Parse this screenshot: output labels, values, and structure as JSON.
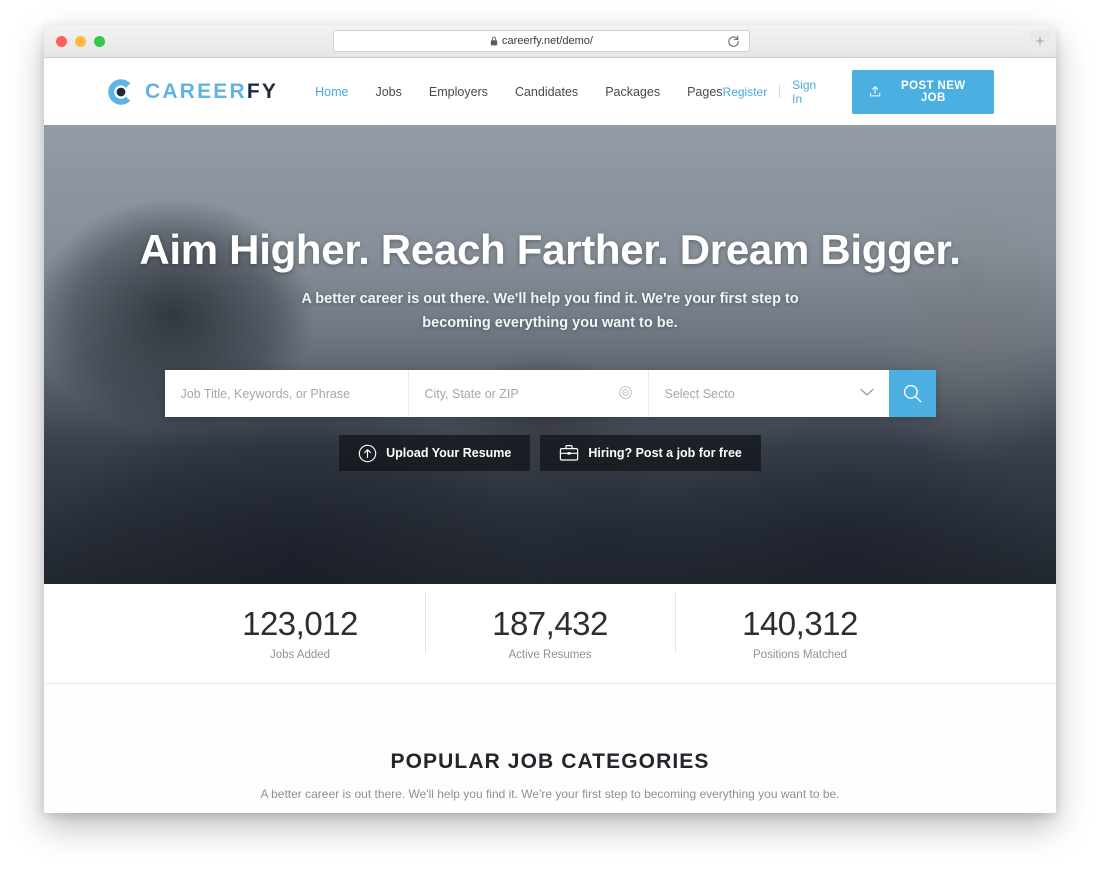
{
  "browser": {
    "url": "careerfy.net/demo/",
    "lock_icon": "lock-icon",
    "reload_icon": "reload-icon",
    "new_tab_label": "+"
  },
  "header": {
    "logo": {
      "icon": "careerfy-c-logo-icon",
      "text_primary": "CAREER",
      "text_secondary": "FY",
      "primary_color": "#5fb4e5",
      "secondary_color": "#1f2b3d"
    },
    "nav": [
      {
        "label": "Home",
        "active": true
      },
      {
        "label": "Jobs",
        "active": false
      },
      {
        "label": "Employers",
        "active": false
      },
      {
        "label": "Candidates",
        "active": false
      },
      {
        "label": "Packages",
        "active": false
      },
      {
        "label": "Pages",
        "active": false
      }
    ],
    "register_label": "Register",
    "signin_label": "Sign In",
    "post_job": {
      "label": "POST NEW JOB",
      "icon": "upload-icon",
      "color": "#4bafe2"
    }
  },
  "hero": {
    "title": "Aim Higher. Reach Farther. Dream Bigger.",
    "subtitle": "A better career is out there. We'll help you find it. We're your first step to becoming everything you want to be.",
    "search": {
      "keywords_placeholder": "Job Title, Keywords, or Phrase",
      "keywords_value": "",
      "location_placeholder": "City, State or ZIP",
      "location_value": "",
      "location_icon": "geolocation-target-icon",
      "sector_value": "Select Secto",
      "sector_icon": "chevron-down-icon",
      "submit_icon": "search-icon",
      "submit_color": "#4bafe2"
    },
    "ctas": [
      {
        "label": "Upload Your Resume",
        "icon": "upload-circle-icon"
      },
      {
        "label": "Hiring? Post a job for free",
        "icon": "briefcase-icon"
      }
    ]
  },
  "counters": [
    {
      "value": "123,012",
      "label": "Jobs Added"
    },
    {
      "value": "187,432",
      "label": "Active Resumes"
    },
    {
      "value": "140,312",
      "label": "Positions Matched"
    }
  ],
  "categories": {
    "title": "POPULAR JOB CATEGORIES",
    "subtitle": "A better career is out there. We'll help you find it. We're your first step to becoming everything you want to be."
  }
}
